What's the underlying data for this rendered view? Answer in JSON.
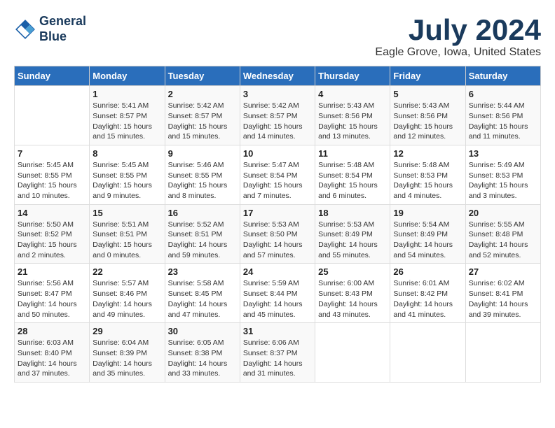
{
  "header": {
    "logo_line1": "General",
    "logo_line2": "Blue",
    "title": "July 2024",
    "subtitle": "Eagle Grove, Iowa, United States"
  },
  "calendar": {
    "days_of_week": [
      "Sunday",
      "Monday",
      "Tuesday",
      "Wednesday",
      "Thursday",
      "Friday",
      "Saturday"
    ],
    "weeks": [
      [
        {
          "day": "",
          "detail": ""
        },
        {
          "day": "1",
          "detail": "Sunrise: 5:41 AM\nSunset: 8:57 PM\nDaylight: 15 hours\nand 15 minutes."
        },
        {
          "day": "2",
          "detail": "Sunrise: 5:42 AM\nSunset: 8:57 PM\nDaylight: 15 hours\nand 15 minutes."
        },
        {
          "day": "3",
          "detail": "Sunrise: 5:42 AM\nSunset: 8:57 PM\nDaylight: 15 hours\nand 14 minutes."
        },
        {
          "day": "4",
          "detail": "Sunrise: 5:43 AM\nSunset: 8:56 PM\nDaylight: 15 hours\nand 13 minutes."
        },
        {
          "day": "5",
          "detail": "Sunrise: 5:43 AM\nSunset: 8:56 PM\nDaylight: 15 hours\nand 12 minutes."
        },
        {
          "day": "6",
          "detail": "Sunrise: 5:44 AM\nSunset: 8:56 PM\nDaylight: 15 hours\nand 11 minutes."
        }
      ],
      [
        {
          "day": "7",
          "detail": "Sunrise: 5:45 AM\nSunset: 8:55 PM\nDaylight: 15 hours\nand 10 minutes."
        },
        {
          "day": "8",
          "detail": "Sunrise: 5:45 AM\nSunset: 8:55 PM\nDaylight: 15 hours\nand 9 minutes."
        },
        {
          "day": "9",
          "detail": "Sunrise: 5:46 AM\nSunset: 8:55 PM\nDaylight: 15 hours\nand 8 minutes."
        },
        {
          "day": "10",
          "detail": "Sunrise: 5:47 AM\nSunset: 8:54 PM\nDaylight: 15 hours\nand 7 minutes."
        },
        {
          "day": "11",
          "detail": "Sunrise: 5:48 AM\nSunset: 8:54 PM\nDaylight: 15 hours\nand 6 minutes."
        },
        {
          "day": "12",
          "detail": "Sunrise: 5:48 AM\nSunset: 8:53 PM\nDaylight: 15 hours\nand 4 minutes."
        },
        {
          "day": "13",
          "detail": "Sunrise: 5:49 AM\nSunset: 8:53 PM\nDaylight: 15 hours\nand 3 minutes."
        }
      ],
      [
        {
          "day": "14",
          "detail": "Sunrise: 5:50 AM\nSunset: 8:52 PM\nDaylight: 15 hours\nand 2 minutes."
        },
        {
          "day": "15",
          "detail": "Sunrise: 5:51 AM\nSunset: 8:51 PM\nDaylight: 15 hours\nand 0 minutes."
        },
        {
          "day": "16",
          "detail": "Sunrise: 5:52 AM\nSunset: 8:51 PM\nDaylight: 14 hours\nand 59 minutes."
        },
        {
          "day": "17",
          "detail": "Sunrise: 5:53 AM\nSunset: 8:50 PM\nDaylight: 14 hours\nand 57 minutes."
        },
        {
          "day": "18",
          "detail": "Sunrise: 5:53 AM\nSunset: 8:49 PM\nDaylight: 14 hours\nand 55 minutes."
        },
        {
          "day": "19",
          "detail": "Sunrise: 5:54 AM\nSunset: 8:49 PM\nDaylight: 14 hours\nand 54 minutes."
        },
        {
          "day": "20",
          "detail": "Sunrise: 5:55 AM\nSunset: 8:48 PM\nDaylight: 14 hours\nand 52 minutes."
        }
      ],
      [
        {
          "day": "21",
          "detail": "Sunrise: 5:56 AM\nSunset: 8:47 PM\nDaylight: 14 hours\nand 50 minutes."
        },
        {
          "day": "22",
          "detail": "Sunrise: 5:57 AM\nSunset: 8:46 PM\nDaylight: 14 hours\nand 49 minutes."
        },
        {
          "day": "23",
          "detail": "Sunrise: 5:58 AM\nSunset: 8:45 PM\nDaylight: 14 hours\nand 47 minutes."
        },
        {
          "day": "24",
          "detail": "Sunrise: 5:59 AM\nSunset: 8:44 PM\nDaylight: 14 hours\nand 45 minutes."
        },
        {
          "day": "25",
          "detail": "Sunrise: 6:00 AM\nSunset: 8:43 PM\nDaylight: 14 hours\nand 43 minutes."
        },
        {
          "day": "26",
          "detail": "Sunrise: 6:01 AM\nSunset: 8:42 PM\nDaylight: 14 hours\nand 41 minutes."
        },
        {
          "day": "27",
          "detail": "Sunrise: 6:02 AM\nSunset: 8:41 PM\nDaylight: 14 hours\nand 39 minutes."
        }
      ],
      [
        {
          "day": "28",
          "detail": "Sunrise: 6:03 AM\nSunset: 8:40 PM\nDaylight: 14 hours\nand 37 minutes."
        },
        {
          "day": "29",
          "detail": "Sunrise: 6:04 AM\nSunset: 8:39 PM\nDaylight: 14 hours\nand 35 minutes."
        },
        {
          "day": "30",
          "detail": "Sunrise: 6:05 AM\nSunset: 8:38 PM\nDaylight: 14 hours\nand 33 minutes."
        },
        {
          "day": "31",
          "detail": "Sunrise: 6:06 AM\nSunset: 8:37 PM\nDaylight: 14 hours\nand 31 minutes."
        },
        {
          "day": "",
          "detail": ""
        },
        {
          "day": "",
          "detail": ""
        },
        {
          "day": "",
          "detail": ""
        }
      ]
    ]
  }
}
